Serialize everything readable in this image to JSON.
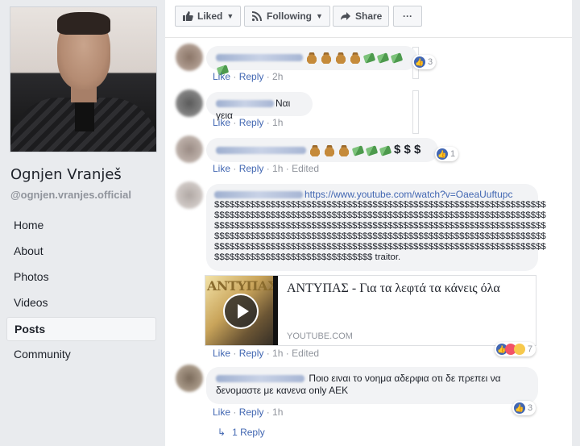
{
  "sidebar": {
    "name": "Ognjen Vranješ",
    "handle": "@ognjen.vranjes.official",
    "nav": [
      "Home",
      "About",
      "Photos",
      "Videos",
      "Posts",
      "Community"
    ],
    "active": "Posts"
  },
  "actions": {
    "liked": "Liked",
    "following": "Following",
    "share": "Share",
    "more": "···"
  },
  "comments": [
    {
      "text": "",
      "reactions": "3",
      "meta": {
        "like": "Like",
        "reply": "Reply",
        "time": "2h"
      }
    },
    {
      "text": "Ναι γεια",
      "meta": {
        "like": "Like",
        "reply": "Reply",
        "time": "1h"
      }
    },
    {
      "text": "$ $ $",
      "reactions": "1",
      "meta": {
        "like": "Like",
        "reply": "Reply",
        "time": "1h",
        "edited": "Edited"
      }
    },
    {
      "url": "https://www.youtube.com/watch?v=OaeaUuftupc",
      "dollar_line": "$$$$$$$$$$$$$$$$$$$$$$$$$$$$$$$$$$$$$$$$$$$$$$$$$$$$$$$$$$$$$$$$$",
      "last_line": "$$$$$$$$$$$$$$$$$$$$$$$$$$$$$$$ traitor.",
      "card": {
        "title": "ΑΝΤΥΠΑΣ - Για τα λεφτά τα κάνεις όλα",
        "domain": "YOUTUBE.COM",
        "thumb_text": "ΑΝΤΥΠΑΣ"
      },
      "reactions": "7",
      "meta": {
        "like": "Like",
        "reply": "Reply",
        "time": "1h",
        "edited": "Edited"
      }
    },
    {
      "text_line1": "Ποιο ειναι το νοημα αδερφια οτι δε πρεπει να",
      "text_line2": "δενομαστε με κανενα only AEK",
      "reactions": "3",
      "meta": {
        "like": "Like",
        "reply": "Reply",
        "time": "1h"
      },
      "replies": "1 Reply"
    }
  ],
  "colors": {
    "link": "#4267b2",
    "meta": "#90949c",
    "bubble": "#f2f3f5",
    "page_bg": "#e9ebee"
  }
}
